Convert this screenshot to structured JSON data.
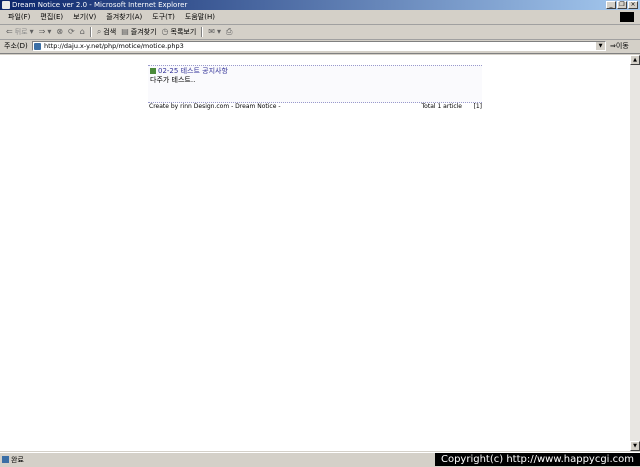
{
  "window": {
    "title": "Dream Notice ver 2.0 - Microsoft Internet Explorer",
    "controls": [
      "_",
      "❐",
      "×"
    ]
  },
  "menu": [
    "파일(F)",
    "편집(E)",
    "보기(V)",
    "즐겨찾기(A)",
    "도구(T)",
    "도움말(H)"
  ],
  "toolbar": {
    "back": "뒤로",
    "search": "검색",
    "favorites": "즐겨찾기",
    "history": "목록보기"
  },
  "address": {
    "label": "주소(D)",
    "value": "http://daju.x-y.net/php/motice/motice.php3",
    "go": "이동"
  },
  "notice": {
    "date": "02-25",
    "title": "테스트 공지사항",
    "body": "다주가 테스트.."
  },
  "footer": {
    "credit": "Create by rinn Design.com - Dream Notice -",
    "total": "Total 1 article",
    "page": "[1]"
  },
  "status": {
    "text": "완료"
  },
  "watermark": "Copyright(c) http://www.happycgi.com"
}
